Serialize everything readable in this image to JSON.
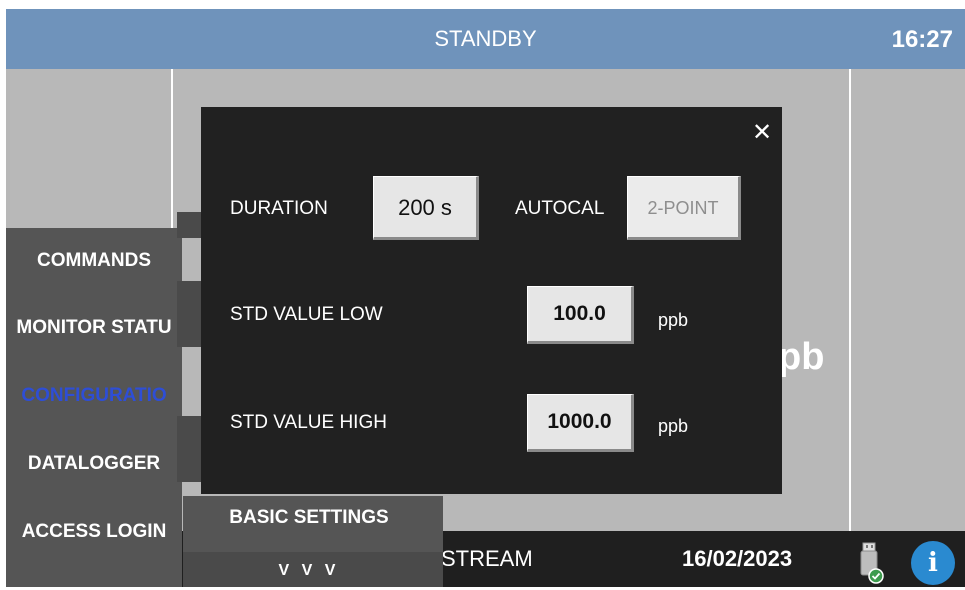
{
  "header": {
    "status": "STANDBY",
    "time": "16:27"
  },
  "background": {
    "unit": "pb"
  },
  "menu": {
    "items": [
      {
        "label": "COMMANDS"
      },
      {
        "label": "MONITOR STATU"
      },
      {
        "label": "CONFIGURATIO"
      },
      {
        "label": "DATALOGGER"
      },
      {
        "label": "ACCESS LOGIN"
      }
    ],
    "submenu_label": "BASIC SETTINGS",
    "expand_label": "V V V"
  },
  "dialog": {
    "duration_label": "DURATION",
    "duration_value": "200 s",
    "autocal_label": "AUTOCAL",
    "autocal_value": "2-POINT",
    "std_low_label": "STD VALUE LOW",
    "std_low_value": "100.0",
    "std_low_unit": "ppb",
    "std_high_label": "STD VALUE HIGH",
    "std_high_value": "1000.0",
    "std_high_unit": "ppb",
    "close_symbol": "✕"
  },
  "footer": {
    "stream": "STREAM",
    "date": "16/02/2023",
    "info_symbol": "i"
  },
  "colors": {
    "header": "#6f93bb",
    "menu_active": "#2e4ed6",
    "dialog_bg": "#212121",
    "info_button": "#2a8ad0"
  }
}
